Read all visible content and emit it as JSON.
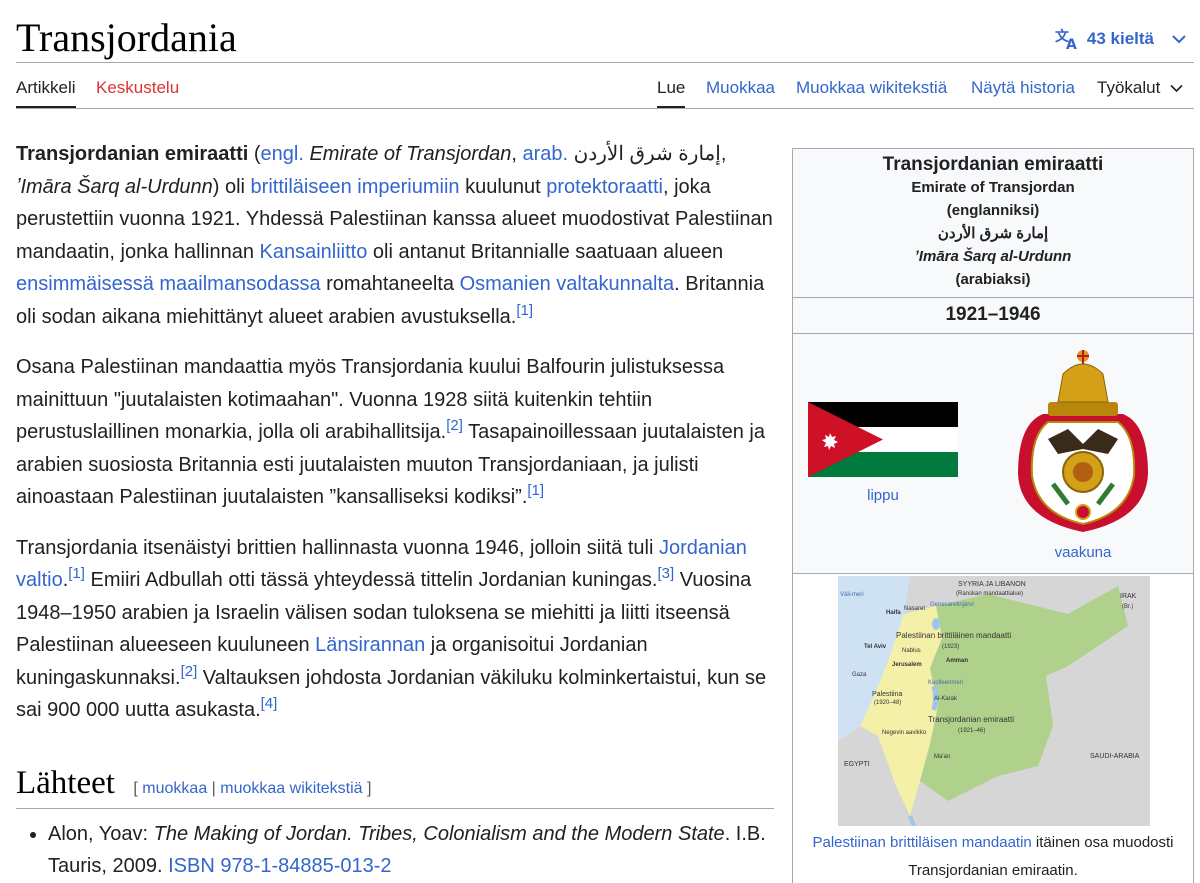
{
  "page": {
    "title": "Transjordania"
  },
  "lang_button": {
    "label": "43 kieltä"
  },
  "tabs": {
    "article": "Artikkeli",
    "talk": "Keskustelu",
    "read": "Lue",
    "edit": "Muokkaa",
    "edit_source": "Muokkaa wikitekstiä",
    "history": "Näytä historia",
    "tools": "Työkalut"
  },
  "p1": {
    "bold": "Transjordanian emiraatti",
    "t1": " (",
    "engl": "engl.",
    "t2": " ",
    "en_name": "Emirate of Transjordan",
    "t3": ", ",
    "arab": "arab.",
    "t4": " إمارة شرق الأردن, ",
    "ar_translit": "ʼImāra Šarq al-Urdunn",
    "t5": ") oli ",
    "l_british": "brittiläiseen imperiumiin",
    "t6": " kuulunut ",
    "l_protect": "protektoraatti",
    "t7": ", joka perustettiin vuonna 1921. Yhdessä Palestiinan kanssa alueet muodostivat Palestiinan mandaatin, jonka hallinnan ",
    "l_league": "Kansainliitto",
    "t8": " oli antanut Britannialle saatuaan alueen ",
    "l_ww1": "ensimmäisessä maailmansodassa",
    "t9": " romahtaneelta ",
    "l_ottoman": "Osmanien valtakunnalta",
    "t10": ". Britannia oli sodan aikana miehittänyt alueet arabien avustuksella.",
    "ref1": "[1]"
  },
  "p2": {
    "t1": "Osana Palestiinan mandaattia myös Transjordania kuului Balfourin julistuksessa mainittuun \"juutalaisten kotimaahan\". Vuonna 1928 siitä kuitenkin tehtiin perustuslaillinen monarkia, jolla oli arabihallitsija.",
    "ref2": "[2]",
    "t2": " Tasapainoillessaan juutalaisten ja arabien suosiosta Britannia esti juutalaisten muuton Transjordaniaan, ja julisti ainoastaan Palestiinan juutalaisten ”kansalliseksi kodiksi”.",
    "ref1": "[1]"
  },
  "p3": {
    "t1": "Transjordania itsenäistyi brittien hallinnasta vuonna 1946, jolloin siitä tuli ",
    "l_jordan": "Jordanian valtio",
    "t2": ".",
    "ref1": "[1]",
    "t3": " Emiiri Adbullah otti tässä yhteydessä tittelin Jordanian kuningas.",
    "ref3": "[3]",
    "t4": " Vuosina 1948–1950 arabien ja Israelin välisen sodan tuloksena se miehitti ja liitti itseensä Palestiinan alueeseen kuuluneen ",
    "l_westbank": "Länsirannan",
    "t5": " ja organisoitui Jordanian kuningaskunnaksi.",
    "ref2": "[2]",
    "t6": " Valtauksen johdosta Jordanian väkiluku kolminkertaistui, kun se sai 900 000 uutta asukasta.",
    "ref4": "[4]"
  },
  "sources": {
    "heading": "Lähteet",
    "bracket_open": "[",
    "edit": "muokkaa",
    "sep": "|",
    "edit_source": "muokkaa wikitekstiä",
    "bracket_close": "]",
    "ref1": {
      "author": "Alon, Yoav: ",
      "title": "The Making of Jordan. Tribes, Colonialism and the Modern State",
      "rest": ". I.B. Tauris, 2009. ",
      "isbn": "ISBN 978-1-84885-013-2"
    }
  },
  "infobox": {
    "title": "Transjordanian emiraatti",
    "en_name": "Emirate of Transjordan",
    "en_note": "(englanniksi)",
    "ar_name": "إمارة شرق الأردن",
    "ar_translit": "ʼImāra Šarq al-Urdunn",
    "ar_note": "(arabiaksi)",
    "years": "1921–1946",
    "flag_caption": "lippu",
    "coa_caption": "vaakuna",
    "map_caption_link": "Palestiinan brittiläisen mandaatin",
    "map_caption_rest": " itäinen osa muodosti Transjordanian emiraatin.",
    "map_labels": {
      "syria": "SYYRIA JA LIBANON",
      "syria_sub": "(Ranskan mandaattialue)",
      "iraq": "IRAK",
      "iraq_sub": "(Br.)",
      "sea": "Väli-meri",
      "haifa": "Haifa",
      "nazareth": "Nasaret",
      "mandate": "Palestiinan brittiläinen mandaatti",
      "mandate_sub": "(1923)",
      "telaviv": "Tel Aviv",
      "nablus": "Nablus",
      "jerusalem": "Jerusalem",
      "amman": "Amman",
      "gaza": "Gaza",
      "palestine": "Palestiina",
      "palestine_sub": "(1920–48)",
      "alkarak": "Al-Karak",
      "emirate": "Transjordanian emiraatti",
      "emirate_sub": "(1921–46)",
      "negev": "Negevin aavikko",
      "maan": "Ma'an",
      "egypt": "EGYPTI",
      "saudi": "SAUDI-ARABIA",
      "lake": "Genesaretinjärvi",
      "deadsea": "Kuolleenmeri"
    }
  },
  "colors": {
    "link": "#3366cc",
    "redlink": "#dd3333",
    "map_green": "#a9d07f",
    "map_yellow": "#f4f0a8"
  }
}
